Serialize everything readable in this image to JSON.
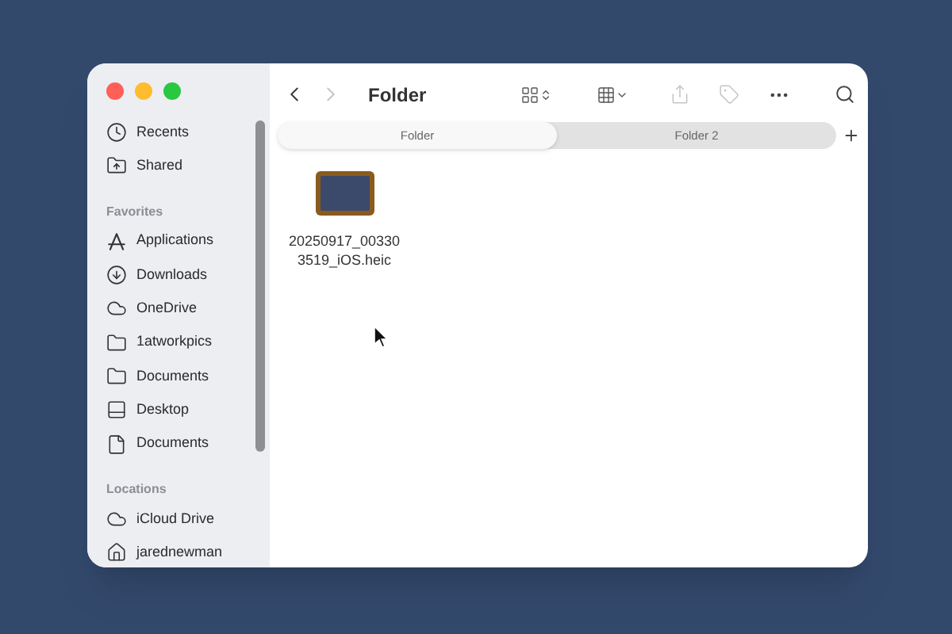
{
  "sidebar": {
    "sections": [
      {
        "items": [
          {
            "label": "Recents"
          },
          {
            "label": "Shared"
          }
        ]
      },
      {
        "heading": "Favorites",
        "items": [
          {
            "label": "Applications"
          },
          {
            "label": "Downloads"
          },
          {
            "label": "OneDrive"
          },
          {
            "label": "1atworkpics"
          },
          {
            "label": "Documents"
          },
          {
            "label": "Desktop"
          },
          {
            "label": "Documents"
          }
        ]
      },
      {
        "heading": "Locations",
        "items": [
          {
            "label": "iCloud Drive"
          },
          {
            "label": "jarednewman"
          }
        ]
      }
    ]
  },
  "toolbar": {
    "title": "Folder",
    "back_disabled": false,
    "forward_disabled": true,
    "share_disabled": true,
    "tag_disabled": true
  },
  "tabs": [
    {
      "label": "Folder",
      "selected": true
    },
    {
      "label": "Folder 2",
      "selected": false
    }
  ],
  "files": [
    {
      "name": "20250917_003303519_iOS.heic"
    }
  ]
}
